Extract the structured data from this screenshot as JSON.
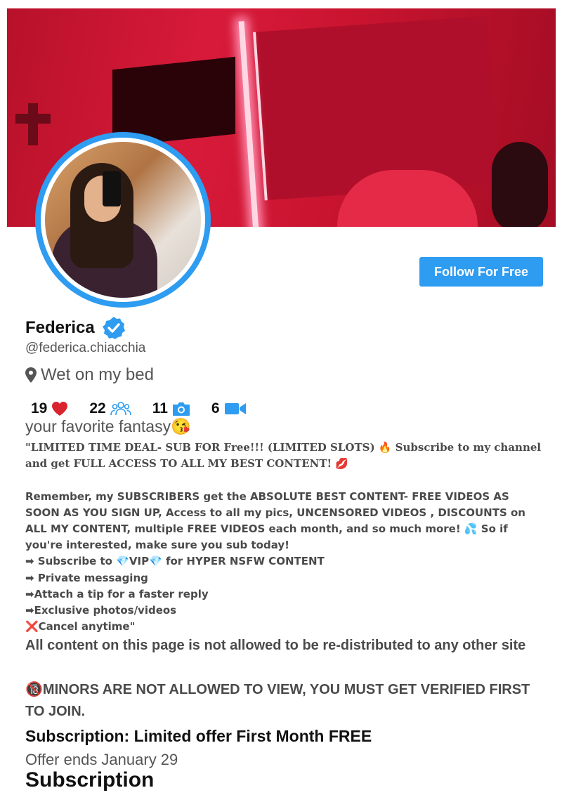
{
  "profile": {
    "name": "Federica",
    "handle": "@federica.chiacchia",
    "location": "Wet on my bed",
    "follow_label": "Follow For Free",
    "tagline": "your favorite fantasy😘"
  },
  "stats": [
    {
      "value": "19",
      "icon": "heart-icon"
    },
    {
      "value": "22",
      "icon": "fans-icon"
    },
    {
      "value": "11",
      "icon": "camera-icon"
    },
    {
      "value": "6",
      "icon": "video-icon"
    }
  ],
  "bio": {
    "line1": "\"LIMITED TIME DEAL- SUB FOR Free!!! (LIMITED SLOTS) 🔥 Subscribe to my channel and get FULL ACCESS TO ALL MY BEST CONTENT! 💋",
    "paragraph": "Remember, my SUBSCRIBERS get the ABSOLUTE BEST CONTENT- FREE VIDEOS AS SOON AS YOU SIGN UP, Access to all my pics, UNCENSORED VIDEOS , DISCOUNTS on ALL MY CONTENT, multiple FREE VIDEOS each month, and so much more! 💦 So if you're interested, make sure you sub today!",
    "bullet1": "➡ Subscribe to 💎VIP💎 for HYPER NSFW CONTENT",
    "bullet2": "➡ Private messaging",
    "bullet3": "➡Attach a tip for a faster reply",
    "bullet4": "➡Exclusive photos/videos",
    "bullet5": "❌Cancel anytime\""
  },
  "notices": {
    "redistribution": "All content on this page is not allowed to be re-distributed to any other site",
    "minors": "🔞MINORS ARE NOT ALLOWED TO VIEW, YOU MUST GET VERIFIED FIRST TO JOIN."
  },
  "subscription": {
    "offer": "Subscription: Limited offer First Month FREE",
    "ends": "Offer ends January 29",
    "title": "Subscription"
  },
  "colors": {
    "accent": "#2e9cf0",
    "heart": "#d9232e"
  }
}
